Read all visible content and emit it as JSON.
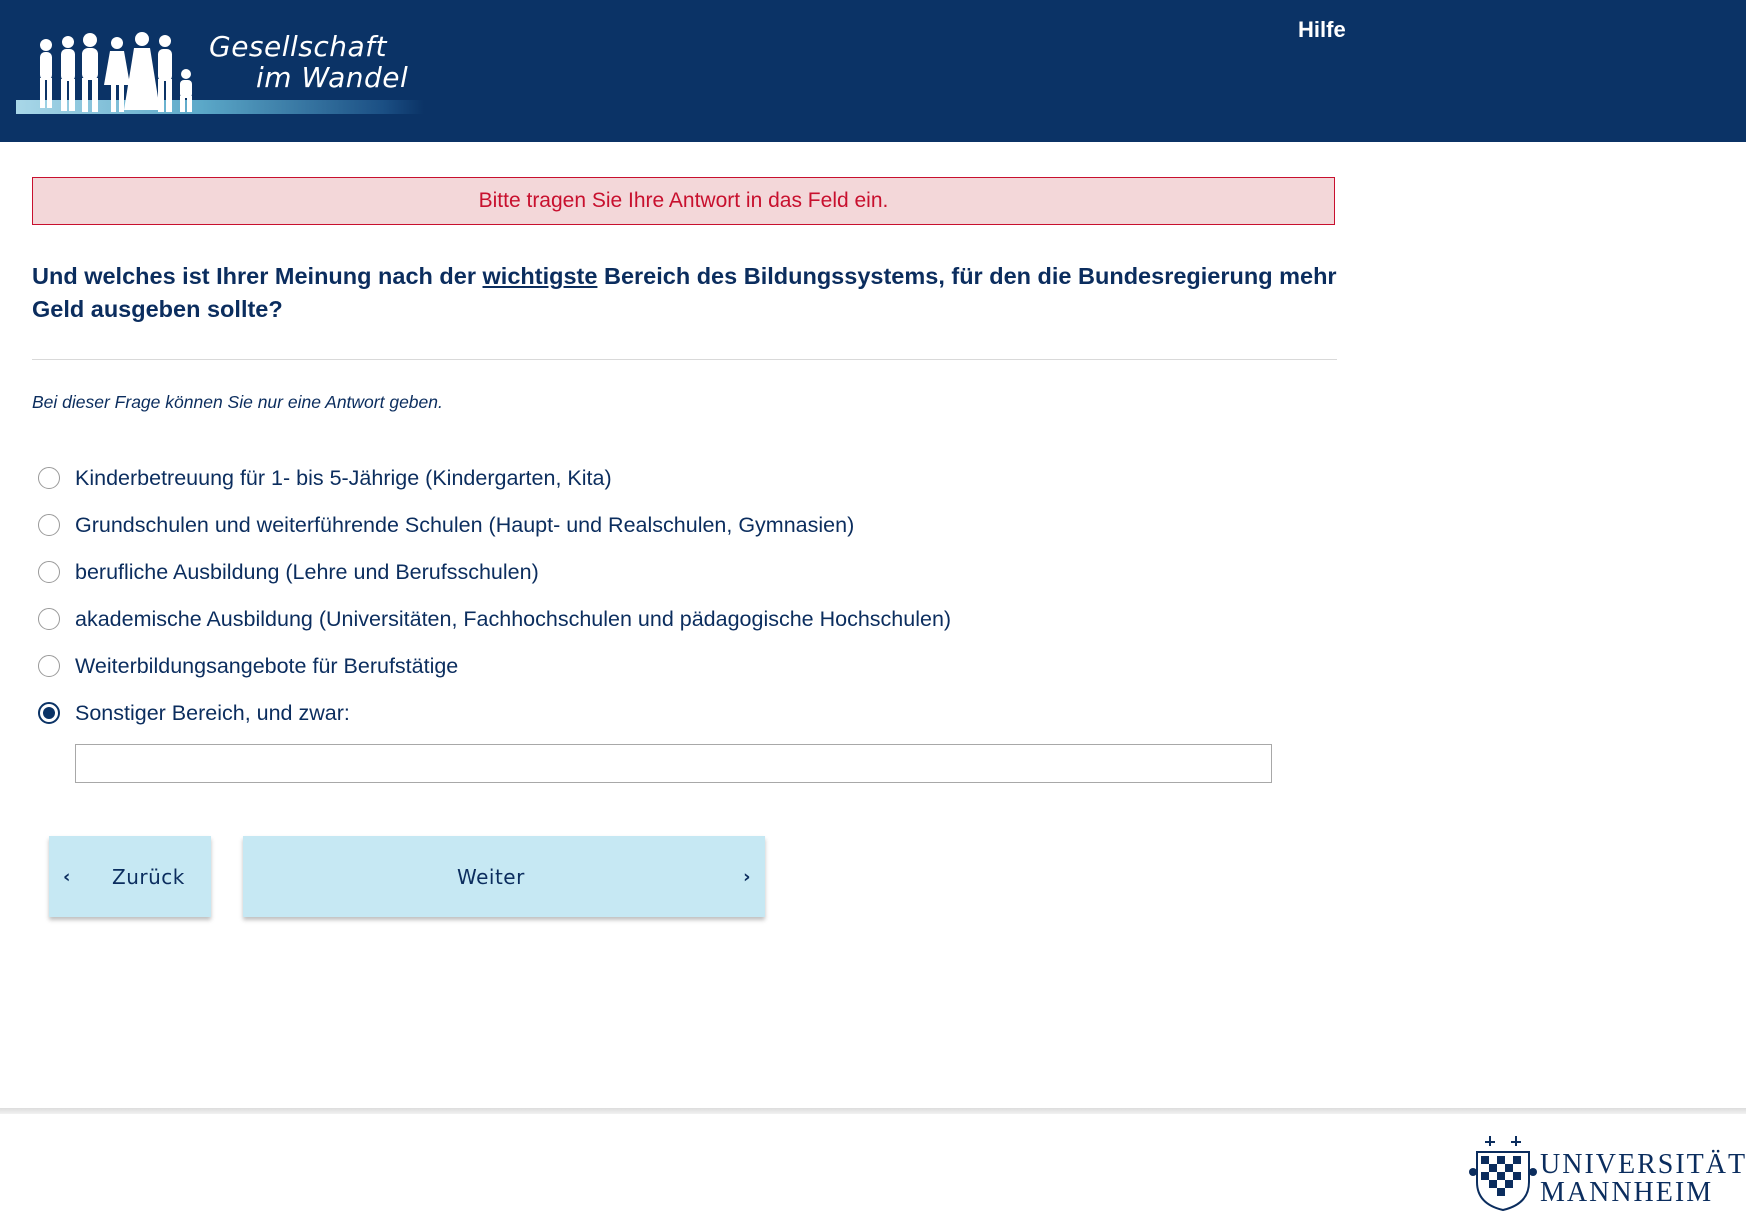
{
  "header": {
    "logo_line1": "Gesellschaft",
    "logo_line2": "im Wandel",
    "help_label": "Hilfe"
  },
  "error_message": "Bitte tragen Sie Ihre Antwort in das Feld ein.",
  "question": {
    "text_before": "Und welches ist Ihrer Meinung nach der ",
    "emphasis": "wichtigste",
    "text_after": " Bereich des Bildungssystems, für den die Bundesregierung mehr Geld ausgeben sollte?"
  },
  "instruction": "Bei dieser Frage können Sie nur eine Antwort geben.",
  "options": [
    {
      "label": "Kinderbetreuung für 1- bis 5-Jährige (Kindergarten, Kita)",
      "selected": false
    },
    {
      "label": "Grundschulen und weiterführende Schulen (Haupt- und Realschulen, Gymnasien)",
      "selected": false
    },
    {
      "label": "berufliche Ausbildung (Lehre und Berufsschulen)",
      "selected": false
    },
    {
      "label": "akademische Ausbildung (Universitäten, Fachhochschulen und pädagogische Hochschulen)",
      "selected": false
    },
    {
      "label": "Weiterbildungsangebote für Berufstätige",
      "selected": false
    },
    {
      "label": "Sonstiger Bereich, und zwar:",
      "selected": true
    }
  ],
  "other_input": {
    "value": "",
    "placeholder": ""
  },
  "nav": {
    "back_label": "Zurück",
    "next_label": "Weiter"
  },
  "footer": {
    "uni_line1": "UNIVERSITÄT",
    "uni_line2": "MANNHEIM"
  },
  "colors": {
    "header_bg": "#0b3366",
    "text": "#0b2d5e",
    "error": "#c8102e",
    "error_bg": "#f3d7d9",
    "button_bg": "#c6e8f3"
  }
}
